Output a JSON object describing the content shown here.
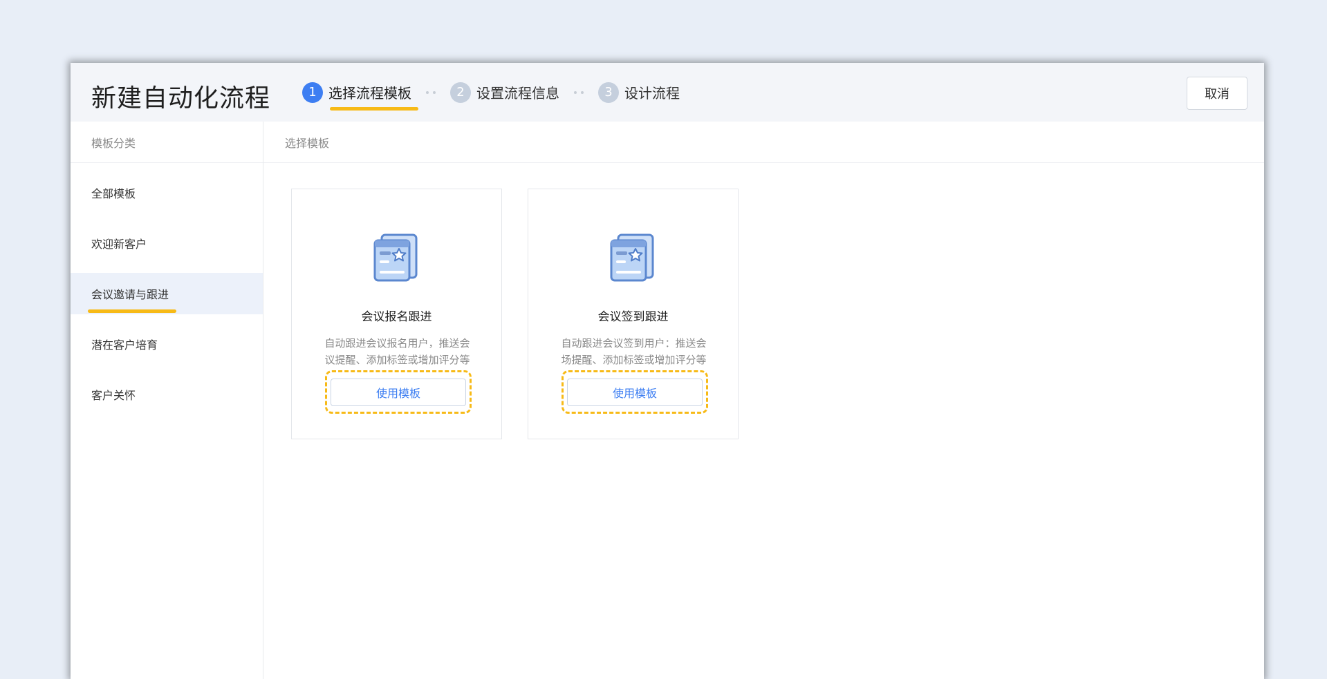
{
  "header": {
    "title": "新建自动化流程",
    "steps": [
      {
        "num": "1",
        "label": "选择流程模板"
      },
      {
        "num": "2",
        "label": "设置流程信息"
      },
      {
        "num": "3",
        "label": "设计流程"
      }
    ],
    "cancel_label": "取消"
  },
  "sidebar": {
    "header": "模板分类",
    "items": [
      {
        "label": "全部模板"
      },
      {
        "label": "欢迎新客户"
      },
      {
        "label": "会议邀请与跟进"
      },
      {
        "label": "潜在客户培育"
      },
      {
        "label": "客户关怀"
      }
    ]
  },
  "main": {
    "header": "选择模板",
    "cards": [
      {
        "title": "会议报名跟进",
        "desc_line1": "自动跟进会议报名用户，推送会",
        "desc_line2": "议提醒、添加标签或增加评分等",
        "button_label": "使用模板"
      },
      {
        "title": "会议签到跟进",
        "desc_line1": "自动跟进会议签到用户：推送会",
        "desc_line2": "场提醒、添加标签或增加评分等",
        "button_label": "使用模板"
      }
    ]
  },
  "colors": {
    "accent": "#3d7ef2",
    "highlight": "#f7ba17"
  },
  "icons": [
    "template-card-icon",
    "star-icon"
  ]
}
